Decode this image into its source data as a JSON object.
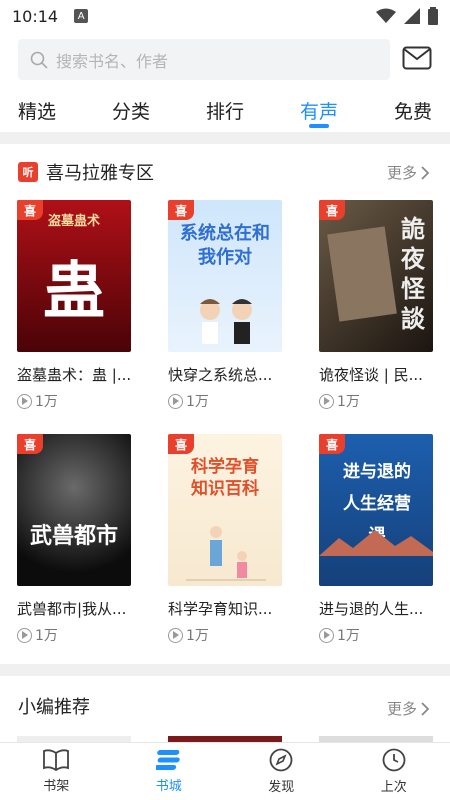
{
  "status_bar": {
    "time": "10:14",
    "notification_letter": "A"
  },
  "search": {
    "placeholder": "搜索书名、作者"
  },
  "tabs": [
    {
      "label": "精选"
    },
    {
      "label": "分类"
    },
    {
      "label": "排行"
    },
    {
      "label": "有声",
      "active": true
    },
    {
      "label": "免费"
    }
  ],
  "ximalaya_section": {
    "logo_text": "听",
    "title": "喜马拉雅专区",
    "more_label": "更多",
    "badge_text": "喜",
    "books": [
      {
        "title": "盗墓蛊术：蛊 |...",
        "plays": "1万",
        "cover_text": "盗墓蛊术",
        "cover_big": "蛊",
        "colors": [
          "#b01017",
          "#4a0307"
        ]
      },
      {
        "title": "快穿之系统总...",
        "plays": "1万",
        "cover_text": "系统总在和我作对",
        "cover_big": "",
        "colors": [
          "#cfe6fb",
          "#e9f3fd"
        ]
      },
      {
        "title": "诡夜怪谈 | 民...",
        "plays": "1万",
        "cover_text": "詭夜怪談",
        "cover_big": "",
        "colors": [
          "#5a4a3a",
          "#1b1510"
        ]
      },
      {
        "title": "武兽都市|我从...",
        "plays": "1万",
        "cover_text": "武兽都市",
        "cover_big": "",
        "colors": [
          "#3a3a3a",
          "#0c0c0c"
        ]
      },
      {
        "title": "科学孕育知识...",
        "plays": "1万",
        "cover_text": "科学孕育知识百科",
        "cover_big": "",
        "colors": [
          "#fdf3e1",
          "#f7e9d0"
        ]
      },
      {
        "title": "进与退的人生...",
        "plays": "1万",
        "cover_text": "进与退的人生经营课",
        "cover_big": "",
        "colors": [
          "#1d5fae",
          "#15407a"
        ]
      }
    ]
  },
  "editor_section": {
    "title": "小编推荐",
    "more_label": "更多"
  },
  "bottom_nav": [
    {
      "label": "书架",
      "icon": "book-icon"
    },
    {
      "label": "书城",
      "icon": "store-icon",
      "active": true
    },
    {
      "label": "发现",
      "icon": "compass-icon"
    },
    {
      "label": "上次",
      "icon": "clock-icon"
    }
  ],
  "colors": {
    "accent": "#1e90ff",
    "brand_red": "#e8402c"
  }
}
